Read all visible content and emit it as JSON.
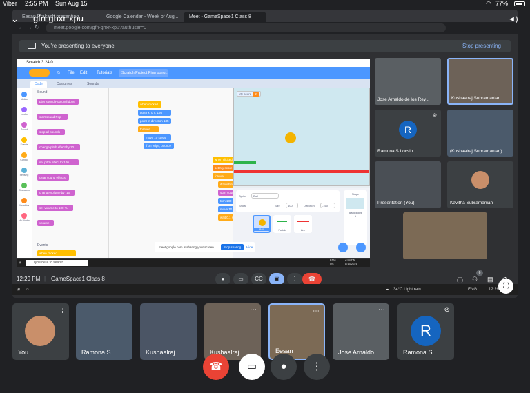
{
  "status_bar": {
    "carrier": "Viber",
    "time": "2:55 PM",
    "date": "Sun Aug 15",
    "battery": "77%"
  },
  "browser": {
    "tabs": [
      {
        "label": "Eesan Prakash presenting",
        "active": false
      },
      {
        "label": "Google Calendar - Week of Aug...",
        "active": false
      },
      {
        "label": "Meet - GameSpace1 Class 8",
        "active": true
      }
    ],
    "overlay_code": "gfn-ghxr-xpu",
    "url": "meet.google.com/gfn-ghxr-xpu?authuser=0"
  },
  "presenting_bar": {
    "label": "You're presenting to everyone",
    "stop_label": "Stop presenting"
  },
  "scratch": {
    "window_title": "Scratch 3.24.0",
    "menu": {
      "file": "File",
      "edit": "Edit",
      "tutorials": "Tutorials",
      "project": "Scratch Project Ping pong..."
    },
    "tabs": {
      "code": "Code",
      "costumes": "Costumes",
      "sounds": "Sounds"
    },
    "categories": [
      {
        "label": "Motion",
        "color": "#4c97ff"
      },
      {
        "label": "Looks",
        "color": "#9966ff"
      },
      {
        "label": "Sound",
        "color": "#cf63cf"
      },
      {
        "label": "Events",
        "color": "#ffbf00"
      },
      {
        "label": "Control",
        "color": "#ffab19"
      },
      {
        "label": "Sensing",
        "color": "#5cb1d6"
      },
      {
        "label": "Operators",
        "color": "#59c059"
      },
      {
        "label": "Variables",
        "color": "#ff8c1a"
      },
      {
        "label": "My Blocks",
        "color": "#ff6680"
      }
    ],
    "palette_section": "Sound",
    "palette_blocks": [
      "play sound Pop until done",
      "start sound Pop",
      "stop all sounds",
      "change pitch effect by 10",
      "set pitch effect to 100",
      "clear sound effects",
      "change volume by -10",
      "set volume to 100 %",
      "volume"
    ],
    "events_section": "Events",
    "events_block": "when clicked",
    "code_blocks": [
      "when clicked",
      "go to x: 0 y: 166",
      "point in direction 135",
      "forever",
      "move 10 steps",
      "if on edge, bounce",
      "when clicked",
      "set My score to 0",
      "forever",
      "if touching Pad",
      "start sound Pop",
      "turn 180 degrees",
      "move 10 steps",
      "wait 0.1 seconds"
    ],
    "variable_monitor": {
      "label": "My score",
      "value": "2"
    },
    "sprite_info": {
      "sprite_label": "Sprite",
      "sprite_value": "Ball",
      "show_label": "Show",
      "size_label": "Size",
      "size_value": "100",
      "direction_label": "Direction",
      "direction_value": "-160"
    },
    "sprites": [
      "Ball",
      "Paddle",
      "Line"
    ],
    "stage_label": "Stage",
    "backdrops_label": "Backdrops",
    "backdrops_count": "1"
  },
  "share_notice": {
    "text": "meet.google.com is sharing your screen.",
    "stop": "Stop sharing",
    "hide": "Hide"
  },
  "windows_taskbar": {
    "search": "Type here to search",
    "lang": "ENG",
    "region": "US",
    "time": "2:55 PM",
    "date": "8/15/2021"
  },
  "side_participants": [
    {
      "name": "Jose Arnaldo de los Rey..."
    },
    {
      "name": "Kushaalraj Subramanian"
    },
    {
      "name": "Ramona S Locsin",
      "initial": "R"
    },
    {
      "name": "(Kushaalraj Subramanian)"
    },
    {
      "name": "Presentation (You)"
    },
    {
      "name": "Kavitha Subramanian"
    }
  ],
  "meet_footer": {
    "time": "12:29 PM",
    "meeting_name": "GameSpace1 Class 8",
    "participants_count": "6"
  },
  "outer_taskbar": {
    "weather": "34°C  Light rain",
    "lang": "ENG",
    "time": "12:29"
  },
  "bottom_tiles": [
    {
      "name": "You"
    },
    {
      "name": "Ramona S"
    },
    {
      "name": "Kushaalraj"
    },
    {
      "name": "Kushaalraj"
    },
    {
      "name": "Eesan"
    },
    {
      "name": "Jose Arnaldo"
    },
    {
      "name": "Ramona S",
      "initial": "R"
    }
  ],
  "colors": {
    "end_call": "#ea4335",
    "accent_blue": "#8ab4f8",
    "scratch_blue": "#4c97ff"
  }
}
